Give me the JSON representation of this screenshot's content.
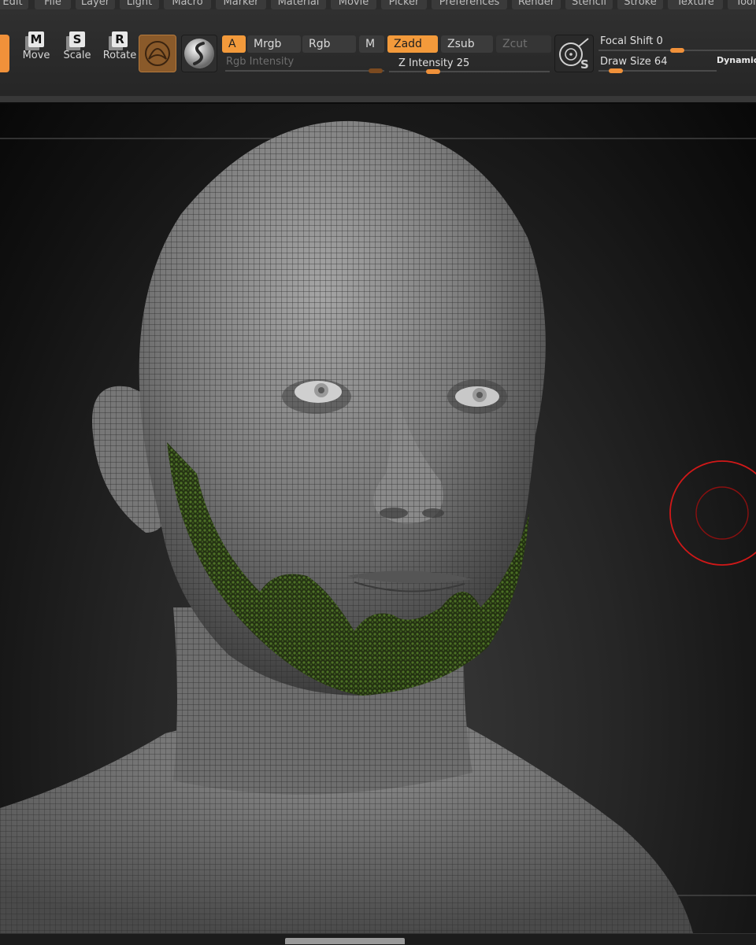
{
  "menu": {
    "items": [
      "Edit",
      "File",
      "Layer",
      "Light",
      "Macro",
      "Marker",
      "Material",
      "Movie",
      "Picker",
      "Preferences",
      "Render",
      "Stencil",
      "Stroke",
      "Texture",
      "Tool"
    ]
  },
  "toolbar": {
    "transform": [
      {
        "letter": "M",
        "label": "Move"
      },
      {
        "letter": "S",
        "label": "Scale"
      },
      {
        "letter": "R",
        "label": "Rotate"
      }
    ],
    "modes": {
      "a_label": "A",
      "mrgb_label": "Mrgb",
      "rgb_label": "Rgb",
      "m_label": "M",
      "zadd_label": "Zadd",
      "zsub_label": "Zsub",
      "zcut_label": "Zcut"
    },
    "rgb_intensity": {
      "label": "Rgb Intensity",
      "value": null
    },
    "z_intensity": {
      "label": "Z Intensity",
      "value": "25",
      "level": 0.25
    },
    "focal_shift": {
      "label": "Focal Shift",
      "value": "0",
      "level": 0.5
    },
    "draw_size": {
      "label": "Draw Size",
      "value": "64",
      "level": 0.1
    },
    "dynamic_label": "Dynamic",
    "spotlight_letter": "S"
  },
  "colors": {
    "accent": "#f39a3b",
    "mesh": "#8f8f8f",
    "mask_green": "#3f5f1f",
    "cursor_red": "#d01818"
  },
  "icons": [
    "move-icon",
    "scale-icon",
    "rotate-icon",
    "sculpt-mode-icon",
    "standard-brush-icon",
    "spotlight-icon",
    "brush-cursor-icon"
  ]
}
